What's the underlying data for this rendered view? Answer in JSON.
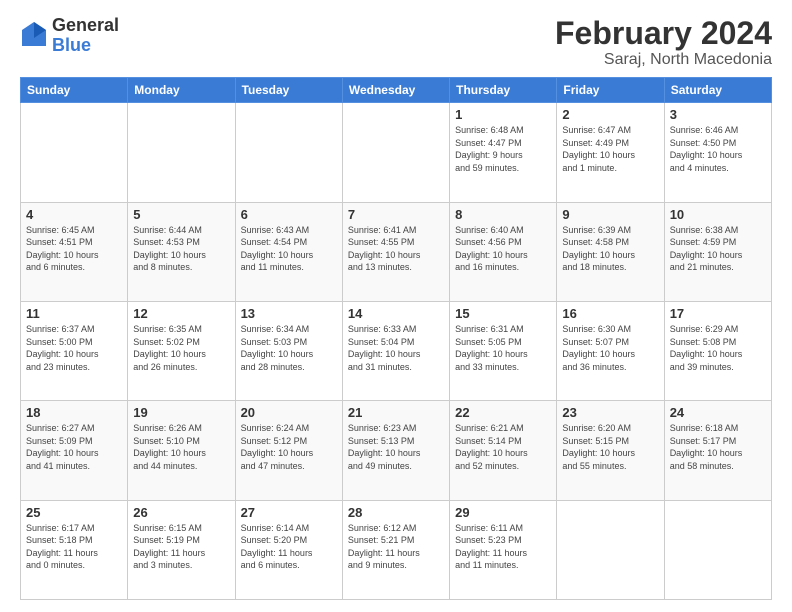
{
  "logo": {
    "general": "General",
    "blue": "Blue"
  },
  "header": {
    "month": "February 2024",
    "location": "Saraj, North Macedonia"
  },
  "days_of_week": [
    "Sunday",
    "Monday",
    "Tuesday",
    "Wednesday",
    "Thursday",
    "Friday",
    "Saturday"
  ],
  "weeks": [
    [
      {
        "day": "",
        "info": ""
      },
      {
        "day": "",
        "info": ""
      },
      {
        "day": "",
        "info": ""
      },
      {
        "day": "",
        "info": ""
      },
      {
        "day": "1",
        "info": "Sunrise: 6:48 AM\nSunset: 4:47 PM\nDaylight: 9 hours\nand 59 minutes."
      },
      {
        "day": "2",
        "info": "Sunrise: 6:47 AM\nSunset: 4:49 PM\nDaylight: 10 hours\nand 1 minute."
      },
      {
        "day": "3",
        "info": "Sunrise: 6:46 AM\nSunset: 4:50 PM\nDaylight: 10 hours\nand 4 minutes."
      }
    ],
    [
      {
        "day": "4",
        "info": "Sunrise: 6:45 AM\nSunset: 4:51 PM\nDaylight: 10 hours\nand 6 minutes."
      },
      {
        "day": "5",
        "info": "Sunrise: 6:44 AM\nSunset: 4:53 PM\nDaylight: 10 hours\nand 8 minutes."
      },
      {
        "day": "6",
        "info": "Sunrise: 6:43 AM\nSunset: 4:54 PM\nDaylight: 10 hours\nand 11 minutes."
      },
      {
        "day": "7",
        "info": "Sunrise: 6:41 AM\nSunset: 4:55 PM\nDaylight: 10 hours\nand 13 minutes."
      },
      {
        "day": "8",
        "info": "Sunrise: 6:40 AM\nSunset: 4:56 PM\nDaylight: 10 hours\nand 16 minutes."
      },
      {
        "day": "9",
        "info": "Sunrise: 6:39 AM\nSunset: 4:58 PM\nDaylight: 10 hours\nand 18 minutes."
      },
      {
        "day": "10",
        "info": "Sunrise: 6:38 AM\nSunset: 4:59 PM\nDaylight: 10 hours\nand 21 minutes."
      }
    ],
    [
      {
        "day": "11",
        "info": "Sunrise: 6:37 AM\nSunset: 5:00 PM\nDaylight: 10 hours\nand 23 minutes."
      },
      {
        "day": "12",
        "info": "Sunrise: 6:35 AM\nSunset: 5:02 PM\nDaylight: 10 hours\nand 26 minutes."
      },
      {
        "day": "13",
        "info": "Sunrise: 6:34 AM\nSunset: 5:03 PM\nDaylight: 10 hours\nand 28 minutes."
      },
      {
        "day": "14",
        "info": "Sunrise: 6:33 AM\nSunset: 5:04 PM\nDaylight: 10 hours\nand 31 minutes."
      },
      {
        "day": "15",
        "info": "Sunrise: 6:31 AM\nSunset: 5:05 PM\nDaylight: 10 hours\nand 33 minutes."
      },
      {
        "day": "16",
        "info": "Sunrise: 6:30 AM\nSunset: 5:07 PM\nDaylight: 10 hours\nand 36 minutes."
      },
      {
        "day": "17",
        "info": "Sunrise: 6:29 AM\nSunset: 5:08 PM\nDaylight: 10 hours\nand 39 minutes."
      }
    ],
    [
      {
        "day": "18",
        "info": "Sunrise: 6:27 AM\nSunset: 5:09 PM\nDaylight: 10 hours\nand 41 minutes."
      },
      {
        "day": "19",
        "info": "Sunrise: 6:26 AM\nSunset: 5:10 PM\nDaylight: 10 hours\nand 44 minutes."
      },
      {
        "day": "20",
        "info": "Sunrise: 6:24 AM\nSunset: 5:12 PM\nDaylight: 10 hours\nand 47 minutes."
      },
      {
        "day": "21",
        "info": "Sunrise: 6:23 AM\nSunset: 5:13 PM\nDaylight: 10 hours\nand 49 minutes."
      },
      {
        "day": "22",
        "info": "Sunrise: 6:21 AM\nSunset: 5:14 PM\nDaylight: 10 hours\nand 52 minutes."
      },
      {
        "day": "23",
        "info": "Sunrise: 6:20 AM\nSunset: 5:15 PM\nDaylight: 10 hours\nand 55 minutes."
      },
      {
        "day": "24",
        "info": "Sunrise: 6:18 AM\nSunset: 5:17 PM\nDaylight: 10 hours\nand 58 minutes."
      }
    ],
    [
      {
        "day": "25",
        "info": "Sunrise: 6:17 AM\nSunset: 5:18 PM\nDaylight: 11 hours\nand 0 minutes."
      },
      {
        "day": "26",
        "info": "Sunrise: 6:15 AM\nSunset: 5:19 PM\nDaylight: 11 hours\nand 3 minutes."
      },
      {
        "day": "27",
        "info": "Sunrise: 6:14 AM\nSunset: 5:20 PM\nDaylight: 11 hours\nand 6 minutes."
      },
      {
        "day": "28",
        "info": "Sunrise: 6:12 AM\nSunset: 5:21 PM\nDaylight: 11 hours\nand 9 minutes."
      },
      {
        "day": "29",
        "info": "Sunrise: 6:11 AM\nSunset: 5:23 PM\nDaylight: 11 hours\nand 11 minutes."
      },
      {
        "day": "",
        "info": ""
      },
      {
        "day": "",
        "info": ""
      }
    ]
  ]
}
